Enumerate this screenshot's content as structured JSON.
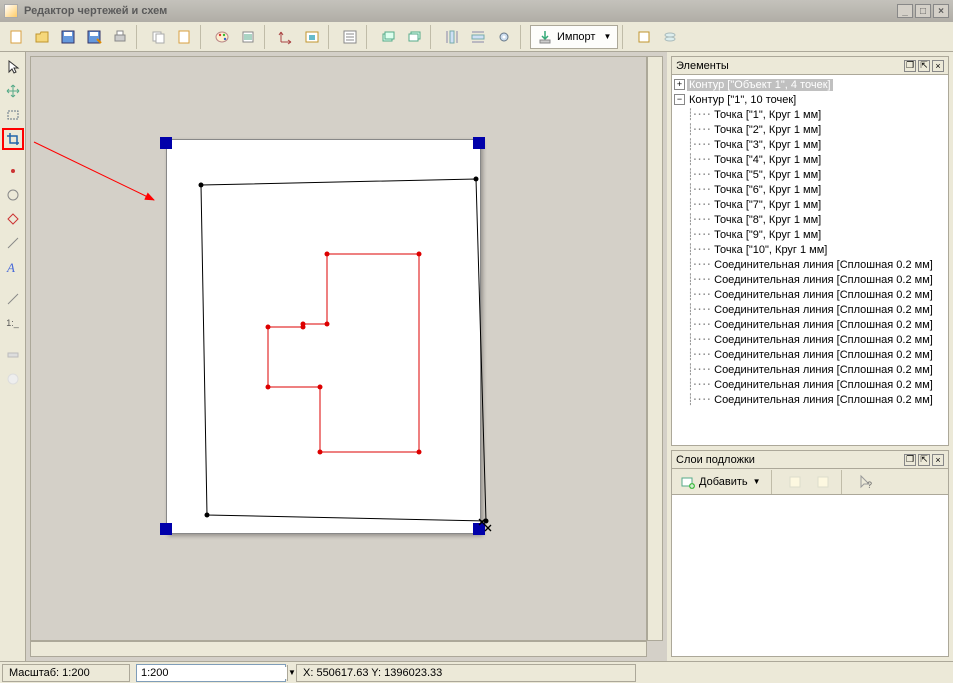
{
  "window": {
    "title": "Редактор чертежей и схем"
  },
  "toolbar": {
    "import_label": "Импорт"
  },
  "panels": {
    "elements": {
      "title": "Элементы",
      "root1": "Контур [\"Объект 1\", 4 точек]",
      "root2": "Контур [\"1\", 10 точек]",
      "points": [
        "Точка [\"1\", Круг 1 мм]",
        "Точка [\"2\", Круг 1 мм]",
        "Точка [\"3\", Круг 1 мм]",
        "Точка [\"4\", Круг 1 мм]",
        "Точка [\"5\", Круг 1 мм]",
        "Точка [\"6\", Круг 1 мм]",
        "Точка [\"7\", Круг 1 мм]",
        "Точка [\"8\", Круг 1 мм]",
        "Точка [\"9\", Круг 1 мм]",
        "Точка [\"10\", Круг 1 мм]"
      ],
      "lines": [
        "Соединительная линия [Сплошная 0.2 мм]",
        "Соединительная линия [Сплошная 0.2 мм]",
        "Соединительная линия [Сплошная 0.2 мм]",
        "Соединительная линия [Сплошная 0.2 мм]",
        "Соединительная линия [Сплошная 0.2 мм]",
        "Соединительная линия [Сплошная 0.2 мм]",
        "Соединительная линия [Сплошная 0.2 мм]",
        "Соединительная линия [Сплошная 0.2 мм]",
        "Соединительная линия [Сплошная 0.2 мм]",
        "Соединительная линия [Сплошная 0.2 мм]"
      ]
    },
    "layers": {
      "title": "Слои подложки",
      "add_label": "Добавить"
    }
  },
  "status": {
    "scale_label": "Масштаб: 1:200",
    "scale_value": "1:200",
    "coords": "X: 550617.63 Y: 1396023.33"
  }
}
